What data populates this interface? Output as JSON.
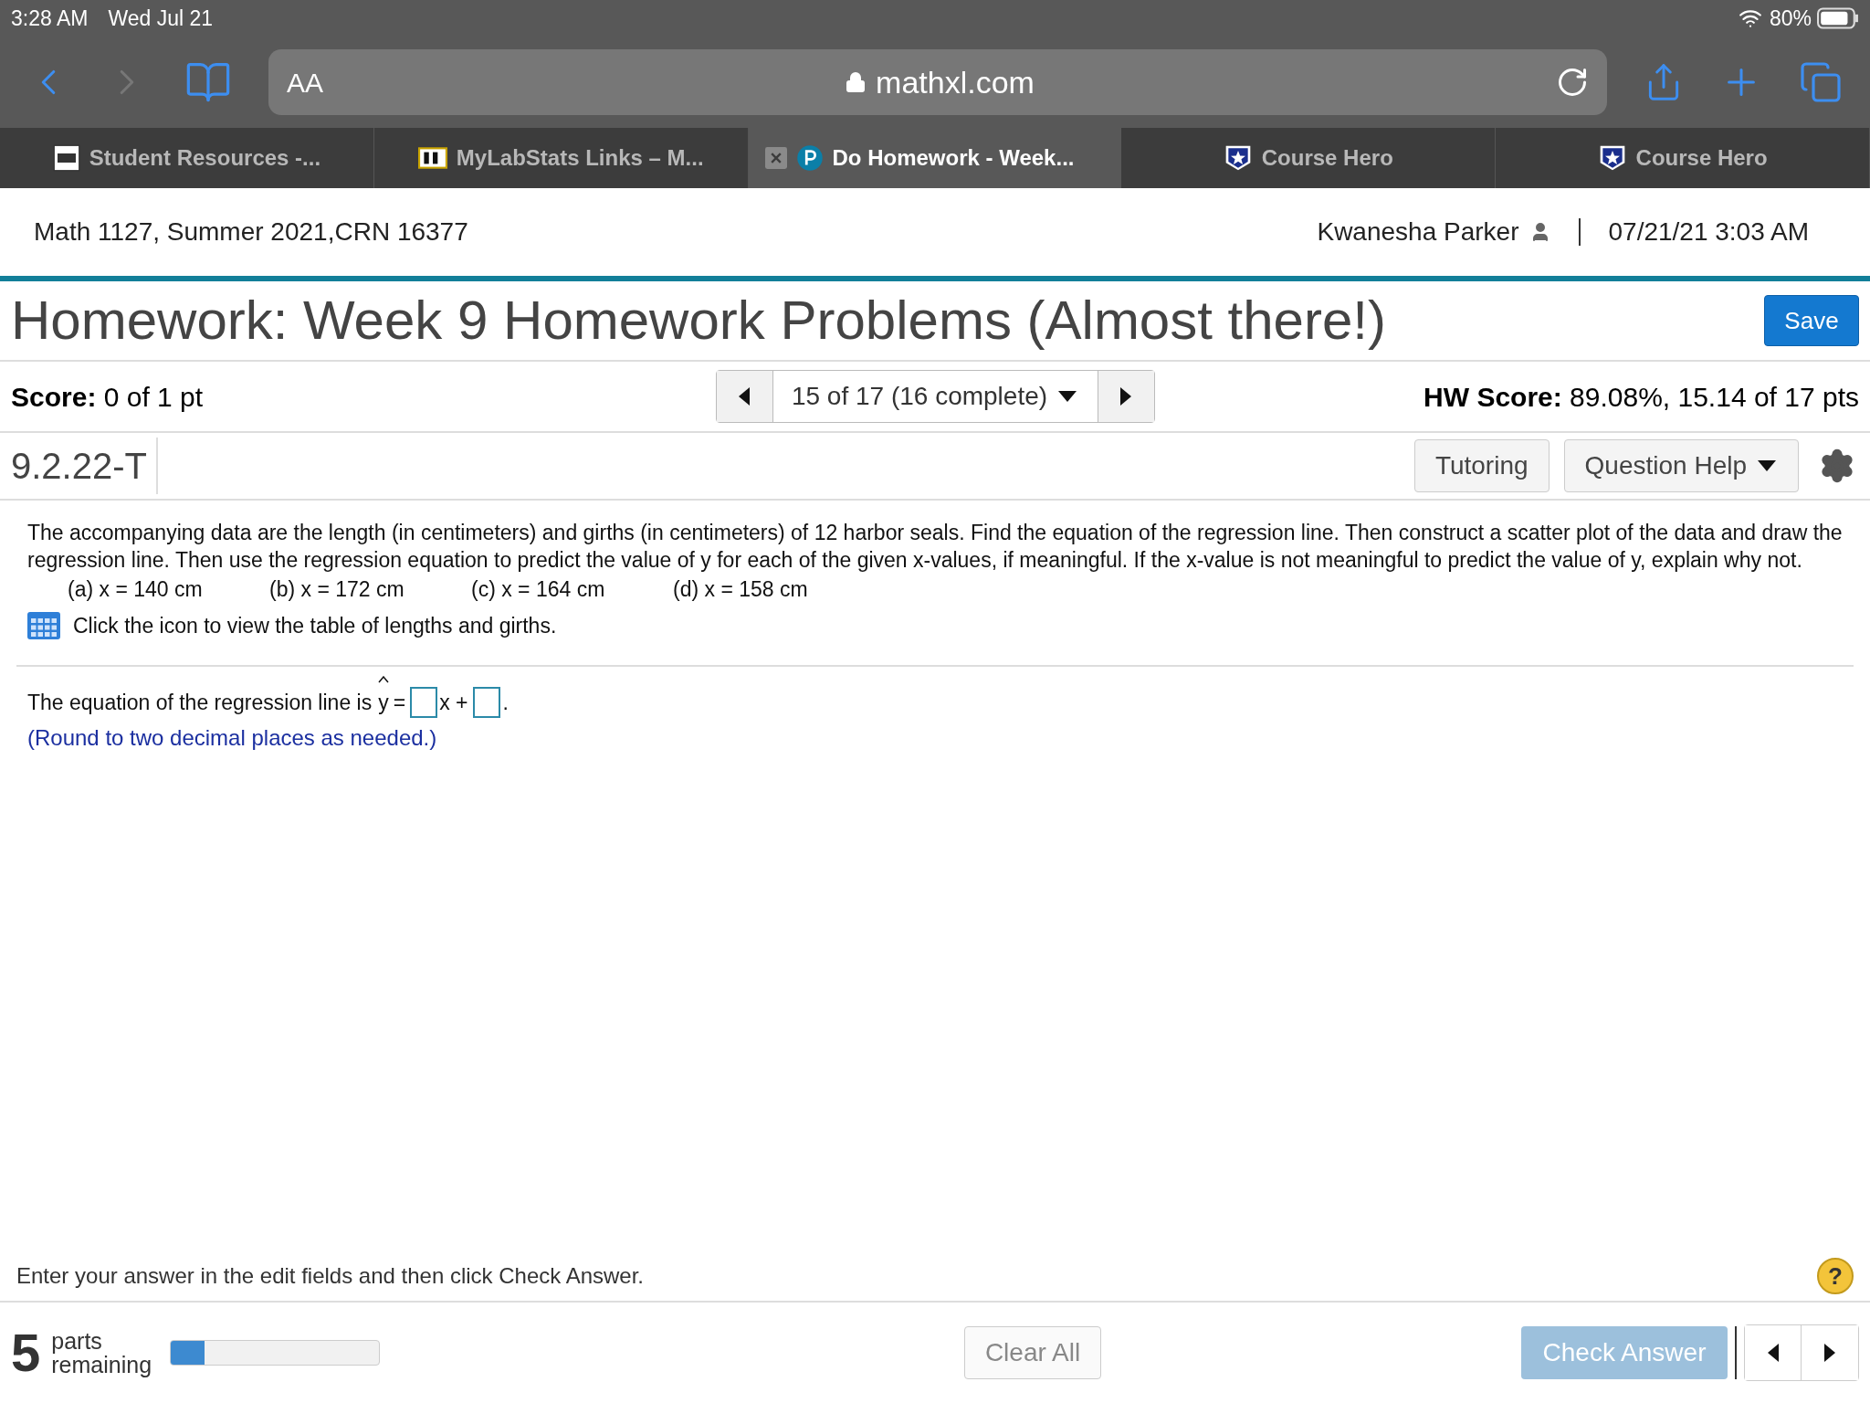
{
  "status_bar": {
    "time": "3:28 AM",
    "date": "Wed Jul 21",
    "battery": "80%"
  },
  "browser": {
    "text_size": "AA",
    "url": "mathxl.com"
  },
  "tabs": [
    {
      "label": "Student Resources -...",
      "selected": false,
      "kind": "college"
    },
    {
      "label": "MyLabStats Links – M...",
      "selected": false,
      "kind": "bb"
    },
    {
      "label": "Do Homework - Week...",
      "selected": true,
      "kind": "pearson"
    },
    {
      "label": "Course Hero",
      "selected": false,
      "kind": "star"
    },
    {
      "label": "Course Hero",
      "selected": false,
      "kind": "star"
    }
  ],
  "course": {
    "title": "Math 1127, Summer 2021,CRN 16377",
    "user": "Kwanesha Parker",
    "datetime": "07/21/21 3:03 AM"
  },
  "homework": {
    "title": "Homework: Week 9 Homework Problems (Almost there!)",
    "save": "Save"
  },
  "score": {
    "label": "Score:",
    "value": "0 of 1 pt",
    "position": "15 of 17 (16 complete)",
    "hw_label": "HW Score:",
    "hw_value": "89.08%, 15.14 of 17 pts"
  },
  "question": {
    "id": "9.2.22-T",
    "tutoring": "Tutoring",
    "help": "Question Help",
    "text": "The accompanying data are the length (in centimeters) and girths (in centimeters) of 12 harbor seals. Find the equation of the regression line. Then construct a scatter plot of the data and draw the regression line. Then use the regression equation to predict the value of y for each of the given x-values, if meaningful. If the x-value is not meaningful to predict the value of y, explain why not.",
    "parts": [
      "(a) x = 140 cm",
      "(b) x = 172 cm",
      "(c) x = 164 cm",
      "(d) x = 158 cm"
    ],
    "table_link": "Click the icon to view the table of lengths and girths."
  },
  "answer": {
    "prefix": "The equation of the regression line is",
    "variable": "y",
    "equals": "=",
    "between": "x +",
    "suffix": ".",
    "note": "(Round to two decimal places as needed.)"
  },
  "footer": {
    "instruction": "Enter your answer in the edit fields and then click Check Answer.",
    "help": "?",
    "parts_count": "5",
    "parts_label": "parts",
    "remaining_label": "remaining",
    "level": 0.16,
    "clear": "Clear All",
    "check": "Check Answer"
  }
}
